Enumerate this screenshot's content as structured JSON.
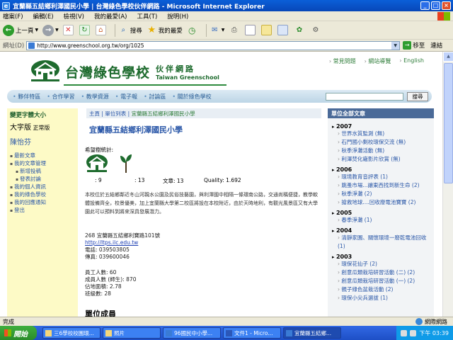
{
  "window": {
    "title": "宜蘭縣五結鄉利澤國民小學 | 台灣綠色學校伙伴網路 - Microsoft Internet Explorer"
  },
  "menu": [
    "檔案(F)",
    "編輯(E)",
    "檢視(V)",
    "我的最愛(A)",
    "工具(T)",
    "說明(H)"
  ],
  "toolbar": {
    "back": "上一頁",
    "search": "搜尋",
    "favorites": "我的最愛"
  },
  "address": {
    "label": "網址(D)",
    "url": "http://www.greenschool.org.tw/org/1025",
    "go": "移至",
    "links": "連結"
  },
  "site": {
    "top_links": [
      "常見問題",
      "網站導覽",
      "English"
    ],
    "title": "台灣綠色學校",
    "partner_cn": "伙伴網路",
    "partner_en": "Taiwan Greenschool",
    "nav": [
      "夥伴特區",
      "合作學習",
      "教學資源",
      "電子報",
      "討論區",
      "關於綠色學校"
    ],
    "search_button": "搜尋"
  },
  "left": {
    "font_size_title": "變更字體大小",
    "font_big": "大字版",
    "font_normal": "正常版",
    "user": "陳怡芬",
    "menu": [
      {
        "label": "最新文章",
        "sub": false
      },
      {
        "label": "我的文章管理",
        "sub": false
      },
      {
        "label": "新增投稿",
        "sub": true
      },
      {
        "label": "發表討論",
        "sub": true
      },
      {
        "label": "我的個人資訊",
        "sub": false
      },
      {
        "label": "我的綠色學校",
        "sub": false
      },
      {
        "label": "我的回應通知",
        "sub": false
      },
      {
        "label": "登出",
        "sub": false
      }
    ]
  },
  "main": {
    "breadcrumb_home": "主頁",
    "breadcrumb_list": "單位列表",
    "breadcrumb_current": "宜蘭縣五結鄉利澤國民小學",
    "school_name": "宜蘭縣五結鄉利澤國民小學",
    "hope_label": "希望樹統計:",
    "tree_count": ": 9",
    "leaf_count": ": 13",
    "articles": "文章: 13",
    "quality": "Quality: 1.692",
    "description": "本校位於五結鄉鄰近冬山河親水公園及民俗技藝園，與利澤國中相隔一條環南公路，交通尚稱便捷，教學軟體設備齊全，校景優美，加上宜蘭縣大學第二校區將設在本校附近，由於天時地利，有觀光風景區又有大學園此可以預料到將來深具發展潛力。",
    "address": "268 宜蘭縣五結鄉利寶路101號",
    "website": "http://ltps.ilc.edu.tw",
    "phone": "電話: 039503805",
    "fax": "傳真: 039600046",
    "staff": "員工人數: 60",
    "members": "成員人數 (師生): 870",
    "area": "佔地面積: 2.78",
    "classes": "班級數: 28",
    "section_title": "單位成員"
  },
  "right": {
    "header": "單位全部文章",
    "years": [
      {
        "year": "2007",
        "items": [
          "世界水質監測 (無)",
          "石門國小剩校環保交流 (無)",
          "秋季淨灘活動 (無)",
          "利澤焚化廠影片欣賞 (無)"
        ]
      },
      {
        "year": "2006",
        "items": [
          "環境教育音評表 (1)",
          "跳蚤市場...讓東西找到新生命 (2)",
          "秋季淨灘 (2)",
          "搶救地球....回收廢電池寶寶 (2)"
        ]
      },
      {
        "year": "2005",
        "items": [
          "春季淨灘 (1)"
        ]
      },
      {
        "year": "2004",
        "items": [
          "清靜家園、關懷環境一廢乾電池回收 (1)"
        ]
      },
      {
        "year": "2003",
        "items": [
          "環保花仙子 (2)",
          "創意瓜類栽培研習活動 (二) (2)",
          "創意瓜類栽培研習活動 (一) (2)",
          "親子綠色盆栽活動 (2)",
          "環保小尖兵選拔 (1)"
        ]
      }
    ]
  },
  "status": {
    "text": "完成",
    "zone": "網際網路"
  },
  "taskbar": {
    "start": "開始",
    "tasks": [
      "三6學校校園環...",
      "照片",
      "96國民中小學...",
      "文件1 - Micro...",
      "宜蘭縣五結鄉..."
    ],
    "clock": "下午 03:39"
  },
  "colors": {
    "brand_green": "#1e6b2e",
    "link_blue": "#2a57a8",
    "left_bg": "#fdfac6",
    "right_header": "#4a6a98"
  }
}
